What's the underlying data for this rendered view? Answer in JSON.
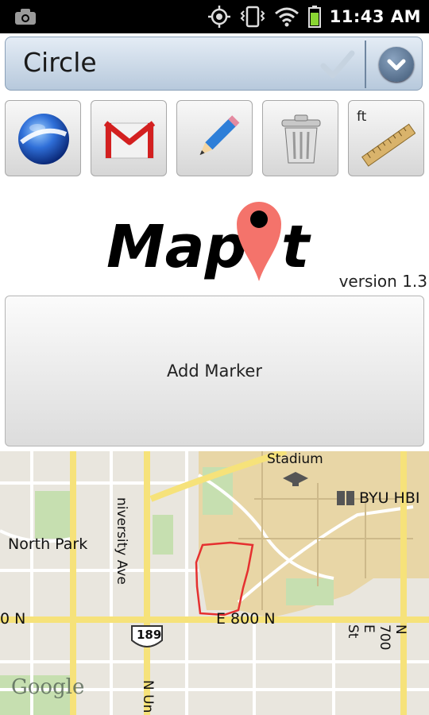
{
  "status_bar": {
    "time": "11:43 AM",
    "icons": [
      "camera-icon",
      "gps-icon",
      "vibrate-icon",
      "wifi-icon",
      "battery-icon"
    ]
  },
  "title_bar": {
    "title": "Circle",
    "icons": [
      "checkmark-icon",
      "dropdown-chevron-icon"
    ]
  },
  "toolbar": {
    "buttons": [
      {
        "name": "google-earth",
        "icon": "globe-icon"
      },
      {
        "name": "gmail",
        "icon": "gmail-icon"
      },
      {
        "name": "edit",
        "icon": "pencil-icon"
      },
      {
        "name": "delete",
        "icon": "trash-icon"
      },
      {
        "name": "measure",
        "icon": "ruler-icon",
        "label": "ft"
      }
    ]
  },
  "logo": {
    "text_left": "Map",
    "text_right": "t"
  },
  "version": "version 1.3",
  "add_marker_label": "Add Marker",
  "map": {
    "labels": {
      "stadium": "Stadium",
      "byu": "BYU HBI",
      "north_park": "North Park",
      "university_ave": "niversity Ave",
      "e800n": "E 800 N",
      "n_left": "0 N",
      "route": "189",
      "n700e": "N 700 E St",
      "n_un": "N Un",
      "google": "Google"
    },
    "colors": {
      "road": "#f6e27a",
      "campus": "#e8d6a6",
      "park": "#c6dfb0",
      "polygon": "#e53030"
    }
  }
}
